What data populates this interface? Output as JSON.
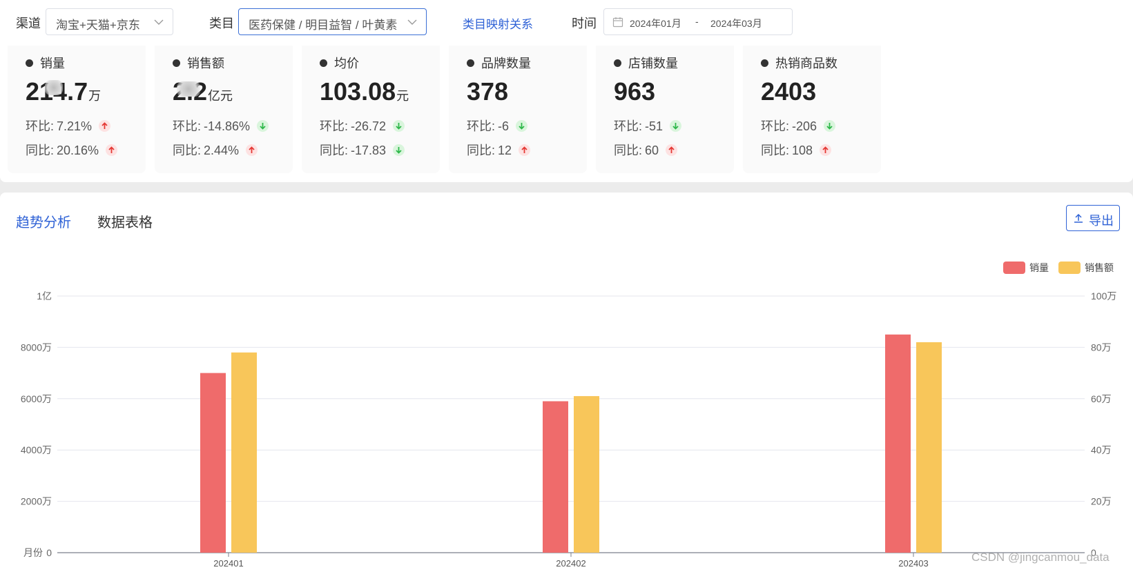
{
  "filters": {
    "channel_label": "渠道",
    "channel_value": "淘宝+天猫+京东",
    "category_label": "类目",
    "category_value": "医药保健 / 明目益智 / 叶黄素",
    "mapping_link": "类目映射关系",
    "time_label": "时间",
    "date_start": "2024年01月",
    "date_sep": "-",
    "date_end": "2024年03月"
  },
  "stats": [
    {
      "title": "销量",
      "value": "214.7",
      "unit": "万",
      "mom_label": "环比:",
      "mom_value": "7.21%",
      "mom_dir": "up",
      "yoy_label": "同比:",
      "yoy_value": "20.16%",
      "yoy_dir": "up"
    },
    {
      "title": "销售额",
      "value": "2.2",
      "unit": "亿元",
      "mom_label": "环比:",
      "mom_value": "-14.86%",
      "mom_dir": "down",
      "yoy_label": "同比:",
      "yoy_value": "2.44%",
      "yoy_dir": "up"
    },
    {
      "title": "均价",
      "value": "103.08",
      "unit": "元",
      "mom_label": "环比:",
      "mom_value": "-26.72",
      "mom_dir": "down",
      "yoy_label": "同比:",
      "yoy_value": "-17.83",
      "yoy_dir": "down"
    },
    {
      "title": "品牌数量",
      "value": "378",
      "unit": "",
      "mom_label": "环比:",
      "mom_value": "-6",
      "mom_dir": "down",
      "yoy_label": "同比:",
      "yoy_value": "12",
      "yoy_dir": "up"
    },
    {
      "title": "店铺数量",
      "value": "963",
      "unit": "",
      "mom_label": "环比:",
      "mom_value": "-51",
      "mom_dir": "down",
      "yoy_label": "同比:",
      "yoy_value": "60",
      "yoy_dir": "up"
    },
    {
      "title": "热销商品数",
      "value": "2403",
      "unit": "",
      "mom_label": "环比:",
      "mom_value": "-206",
      "mom_dir": "down",
      "yoy_label": "同比:",
      "yoy_value": "108",
      "yoy_dir": "up"
    }
  ],
  "tabs": [
    {
      "label": "趋势分析",
      "active": true
    },
    {
      "label": "数据表格",
      "active": false
    }
  ],
  "export_label": "导出",
  "colors": {
    "accent": "#2f62d6",
    "sales_volume": "#ef6b6b",
    "sales_amount": "#f8c65a",
    "up": "#e53935",
    "down": "#2eb84a"
  },
  "chart_data": {
    "type": "bar",
    "categories": [
      "202401",
      "202402",
      "202403"
    ],
    "xlabel": "月份",
    "series": [
      {
        "name": "销量",
        "values": [
          700000,
          590000,
          850000
        ],
        "axis": "right"
      },
      {
        "name": "销售额",
        "values": [
          78000000,
          61000000,
          82000000
        ],
        "axis": "left"
      }
    ],
    "ylim_left": [
      0,
      100000000
    ],
    "ylim_right": [
      0,
      1000000
    ],
    "left_ticks": [
      "0",
      "2000万",
      "4000万",
      "6000万",
      "8000万",
      "1亿"
    ],
    "right_ticks": [
      "0",
      "20万",
      "40万",
      "60万",
      "80万",
      "100万"
    ],
    "legend_position": "top-right",
    "grid": true
  },
  "watermark": "CSDN @jingcanmou_data"
}
